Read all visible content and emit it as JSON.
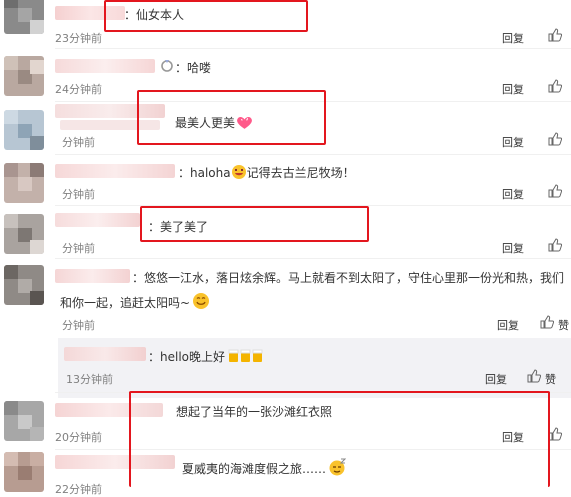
{
  "comments": [
    {
      "prefix": "：",
      "text": "仙女本人",
      "time": "23分钟前",
      "reply": "回复"
    },
    {
      "prefix": "：",
      "text": "哈喽",
      "time": "24分钟前",
      "reply": "回复"
    },
    {
      "text": "最美人更美",
      "time": "分钟前",
      "reply": "回复"
    },
    {
      "text_a": "：haloha",
      "text_b": "记得去古兰尼牧场！",
      "time": "分钟前",
      "reply": "回复"
    },
    {
      "prefix": "：",
      "text": "美了美了",
      "time": "分钟前",
      "reply": "回复"
    },
    {
      "line1": "：悠悠一江水，落日炫余辉。马上就看不到太阳了，守住心里那一份光和热，我们",
      "line2": "和你一起，追赶太阳吗~",
      "time": "分钟前",
      "reply": "回复",
      "like": "赞"
    },
    {
      "text": "：hello晚上好",
      "time": "13分钟前",
      "reply": "回复",
      "like": "赞"
    },
    {
      "text": "想起了当年的一张沙滩红衣照",
      "time": "20分钟前",
      "reply": "回复"
    },
    {
      "text": "夏威夷的海滩度假之旅……",
      "time": "22分钟前"
    }
  ]
}
